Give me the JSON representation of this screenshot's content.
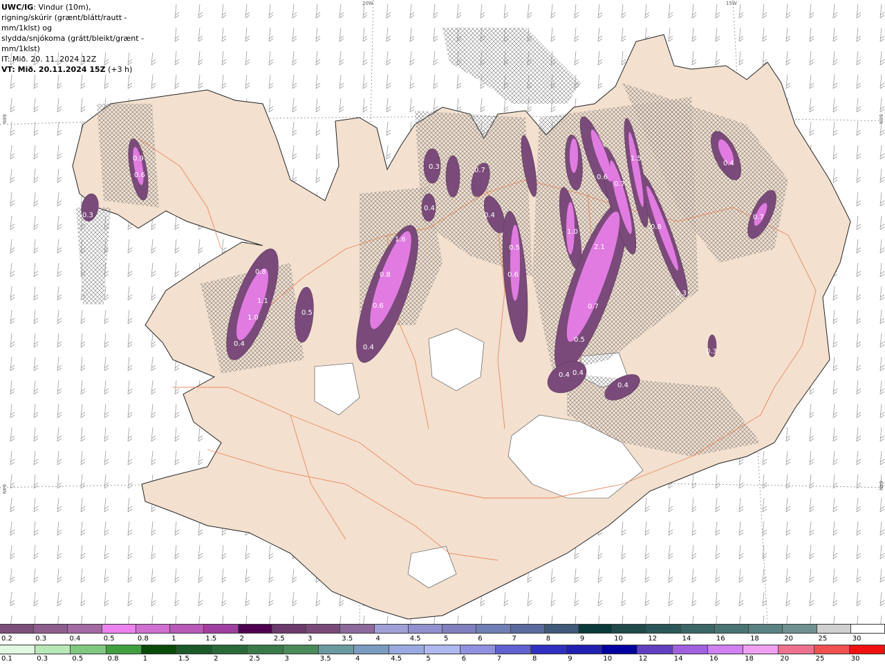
{
  "header": {
    "model": "UWC/IG",
    "line1": ": Vindur (10m),",
    "line2": "rigning/skúrir (grænt/blátt/rautt - mm/1klst) og",
    "line3": "slydda/snjókoma (grátt/bleikt/grænt - mm/1klst)",
    "it": "IT: Mið. 20. 11. 2024 12Z",
    "vt": "VT: Mið. 20.11.2024 15Z",
    "lead": " (+3 h)"
  },
  "coords": {
    "lon_20w": "20W",
    "lon_15w": "15W",
    "lat_66n_left": "66N",
    "lat_66n_right": "66N",
    "lat_64n_left": "64N",
    "lat_64n_right": "64N"
  },
  "cells": [
    {
      "id": "c1",
      "label": "0.3"
    },
    {
      "id": "c2",
      "label": "0.9"
    },
    {
      "id": "c3",
      "label": "0.6"
    },
    {
      "id": "c4",
      "label": "0.8"
    },
    {
      "id": "c5",
      "label": "1.1"
    },
    {
      "id": "c6",
      "label": "1.0"
    },
    {
      "id": "c7",
      "label": "0.4"
    },
    {
      "id": "c8",
      "label": "0.5"
    },
    {
      "id": "c9",
      "label": "1.6"
    },
    {
      "id": "c10",
      "label": "0.8"
    },
    {
      "id": "c11",
      "label": "0.6"
    },
    {
      "id": "c12",
      "label": "0.4"
    },
    {
      "id": "c13",
      "label": "0.3"
    },
    {
      "id": "c14",
      "label": "0.4"
    },
    {
      "id": "c15",
      "label": "0.7"
    },
    {
      "id": "c16",
      "label": "0.4"
    },
    {
      "id": "c17",
      "label": "0.5"
    },
    {
      "id": "c18",
      "label": "0.6"
    },
    {
      "id": "c19",
      "label": "1.0"
    },
    {
      "id": "c20",
      "label": "2.1"
    },
    {
      "id": "c21",
      "label": "0.7"
    },
    {
      "id": "c22",
      "label": "0.5"
    },
    {
      "id": "c23",
      "label": "0.4"
    },
    {
      "id": "c24",
      "label": "0.4"
    },
    {
      "id": "c25",
      "label": "0.4"
    },
    {
      "id": "c26",
      "label": "1.5"
    },
    {
      "id": "c27",
      "label": "0.8"
    },
    {
      "id": "c28",
      "label": "0.3"
    },
    {
      "id": "c29",
      "label": "0.4"
    },
    {
      "id": "c30",
      "label": "0.7"
    },
    {
      "id": "c31",
      "label": "0.3"
    },
    {
      "id": "c32",
      "label": "0.6"
    },
    {
      "id": "c33",
      "label": "0.7"
    }
  ],
  "legend_snow": {
    "labels": [
      "0.2",
      "0.3",
      "0.4",
      "0.5",
      "0.8",
      "1",
      "1.5",
      "2",
      "2.5",
      "3",
      "3.5",
      "4",
      "4.5",
      "5",
      "6",
      "7",
      "8",
      "9",
      "10",
      "12",
      "14",
      "16",
      "18",
      "20",
      "25",
      "30"
    ],
    "colors": [
      "#7b4f7a",
      "#8e5d8d",
      "#a46aa4",
      "#ee82ee",
      "#d070d0",
      "#b85ab8",
      "#a040a0",
      "#500050",
      "#6e3a6e",
      "#7a4a7a",
      "#8c6a9c",
      "#a0a0d8",
      "#9090d0",
      "#8080c0",
      "#6f7fb5",
      "#5a6a9e",
      "#3f5a7a",
      "#0a3a3a",
      "#1e4a4a",
      "#2a5858",
      "#3a6666",
      "#4a7474",
      "#5a8282",
      "#6f9090",
      "#d0d0d0",
      "#ffffff"
    ]
  },
  "legend_rain": {
    "labels": [
      "0.1",
      "0.3",
      "0.5",
      "0.8",
      "1",
      "1.5",
      "2",
      "2.5",
      "3",
      "3.5",
      "4",
      "4.5",
      "5",
      "6",
      "7",
      "8",
      "9",
      "10",
      "12",
      "14",
      "16",
      "18",
      "20",
      "25",
      "30"
    ],
    "colors": [
      "#e0f8e0",
      "#b8e8b8",
      "#80c880",
      "#40a040",
      "#0a4a0a",
      "#1a5a2a",
      "#2a6a3a",
      "#3a7a4a",
      "#4a8a5a",
      "#6a9aa0",
      "#7a9ac0",
      "#9aaae0",
      "#b0b8f0",
      "#9090e0",
      "#6060d0",
      "#3030c0",
      "#2020b0",
      "#0000a0",
      "#6040c0",
      "#a060e0",
      "#d080f0",
      "#f0a0f0",
      "#f07090",
      "#f05050",
      "#f01010"
    ]
  }
}
